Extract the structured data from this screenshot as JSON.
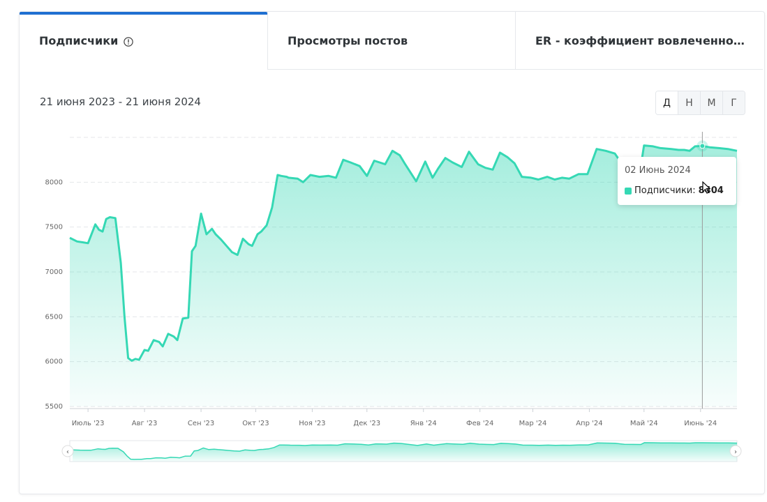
{
  "tabs": [
    {
      "label": "Подписчики",
      "active": true,
      "icon": "info-icon"
    },
    {
      "label": "Просмотры постов",
      "active": false
    },
    {
      "label": "ER - коэффициент вовлеченнос...",
      "active": false
    }
  ],
  "date_range": "21 июня 2023 - 21 июня 2024",
  "period_buttons": [
    "Д",
    "Н",
    "М",
    "Г"
  ],
  "tooltip": {
    "date": "02 Июнь 2024",
    "series": "Подписчики:",
    "value": "8404"
  },
  "colors": {
    "series": "#35d8b4",
    "accent": "#1f6fd1"
  },
  "chart_data": {
    "type": "area",
    "title": "",
    "xlabel": "",
    "ylabel": "",
    "ylim": [
      5500,
      8500
    ],
    "yticks": [
      5500,
      6000,
      6500,
      7000,
      7500,
      8000
    ],
    "xticks": [
      "Июль '23",
      "Авг '23",
      "Сен '23",
      "Окт '23",
      "Ноя '23",
      "Дек '23",
      "Янв '24",
      "Фев '24",
      "Мар '24",
      "Апр '24",
      "Май '24",
      "Июнь '24"
    ],
    "grid": true,
    "legend": "none",
    "series": [
      {
        "name": "Подписчики",
        "x": [
          "2023-06-21",
          "2023-06-25",
          "2023-06-28",
          "2023-07-01",
          "2023-07-05",
          "2023-07-07",
          "2023-07-09",
          "2023-07-11",
          "2023-07-13",
          "2023-07-16",
          "2023-07-19",
          "2023-07-21",
          "2023-07-23",
          "2023-07-25",
          "2023-07-27",
          "2023-07-29",
          "2023-08-01",
          "2023-08-03",
          "2023-08-06",
          "2023-08-09",
          "2023-08-11",
          "2023-08-14",
          "2023-08-17",
          "2023-08-19",
          "2023-08-22",
          "2023-08-25",
          "2023-08-27",
          "2023-08-29",
          "2023-09-01",
          "2023-09-04",
          "2023-09-07",
          "2023-09-09",
          "2023-09-12",
          "2023-09-15",
          "2023-09-18",
          "2023-09-21",
          "2023-09-24",
          "2023-09-27",
          "2023-09-29",
          "2023-10-02",
          "2023-10-04",
          "2023-10-07",
          "2023-10-10",
          "2023-10-13",
          "2023-10-15",
          "2023-10-18",
          "2023-10-19",
          "2023-10-24",
          "2023-10-27",
          "2023-10-31",
          "2023-11-05",
          "2023-11-10",
          "2023-11-14",
          "2023-11-18",
          "2023-11-22",
          "2023-11-27",
          "2023-12-01",
          "2023-12-05",
          "2023-12-08",
          "2023-12-11",
          "2023-12-15",
          "2023-12-19",
          "2023-12-22",
          "2023-12-28",
          "2024-01-02",
          "2024-01-06",
          "2024-01-09",
          "2024-01-13",
          "2024-01-17",
          "2024-01-22",
          "2024-01-26",
          "2024-01-31",
          "2024-02-04",
          "2024-02-08",
          "2024-02-12",
          "2024-02-16",
          "2024-02-20",
          "2024-02-24",
          "2024-02-29",
          "2024-03-04",
          "2024-03-09",
          "2024-03-13",
          "2024-03-17",
          "2024-03-21",
          "2024-03-26",
          "2024-03-31",
          "2024-04-05",
          "2024-04-10",
          "2024-04-15",
          "2024-04-20",
          "2024-04-25",
          "2024-04-29",
          "2024-05-01",
          "2024-05-06",
          "2024-05-10",
          "2024-05-16",
          "2024-05-20",
          "2024-05-23",
          "2024-05-26",
          "2024-05-29",
          "2024-06-02",
          "2024-06-06",
          "2024-06-11",
          "2024-06-16",
          "2024-06-21"
        ],
        "values": [
          7380,
          7340,
          7330,
          7320,
          7530,
          7470,
          7450,
          7590,
          7610,
          7600,
          7100,
          6500,
          6040,
          6010,
          6030,
          6020,
          6130,
          6120,
          6240,
          6220,
          6170,
          6310,
          6280,
          6240,
          6480,
          6490,
          7230,
          7290,
          7650,
          7420,
          7480,
          7420,
          7360,
          7290,
          7220,
          7190,
          7370,
          7310,
          7290,
          7420,
          7450,
          7520,
          7720,
          8080,
          8070,
          8060,
          8050,
          8040,
          8000,
          8080,
          8060,
          8070,
          8050,
          8250,
          8220,
          8180,
          8070,
          8240,
          8220,
          8200,
          8350,
          8300,
          8200,
          8010,
          8230,
          8050,
          8150,
          8270,
          8220,
          8170,
          8340,
          8200,
          8160,
          8140,
          8330,
          8280,
          8210,
          8060,
          8050,
          8030,
          8060,
          8030,
          8050,
          8040,
          8090,
          8090,
          8370,
          8350,
          8320,
          8170,
          8160,
          8150,
          8410,
          8400,
          8380,
          8370,
          8360,
          8360,
          8350,
          8400,
          8404,
          8390,
          8380,
          8370,
          8350
        ]
      }
    ]
  }
}
